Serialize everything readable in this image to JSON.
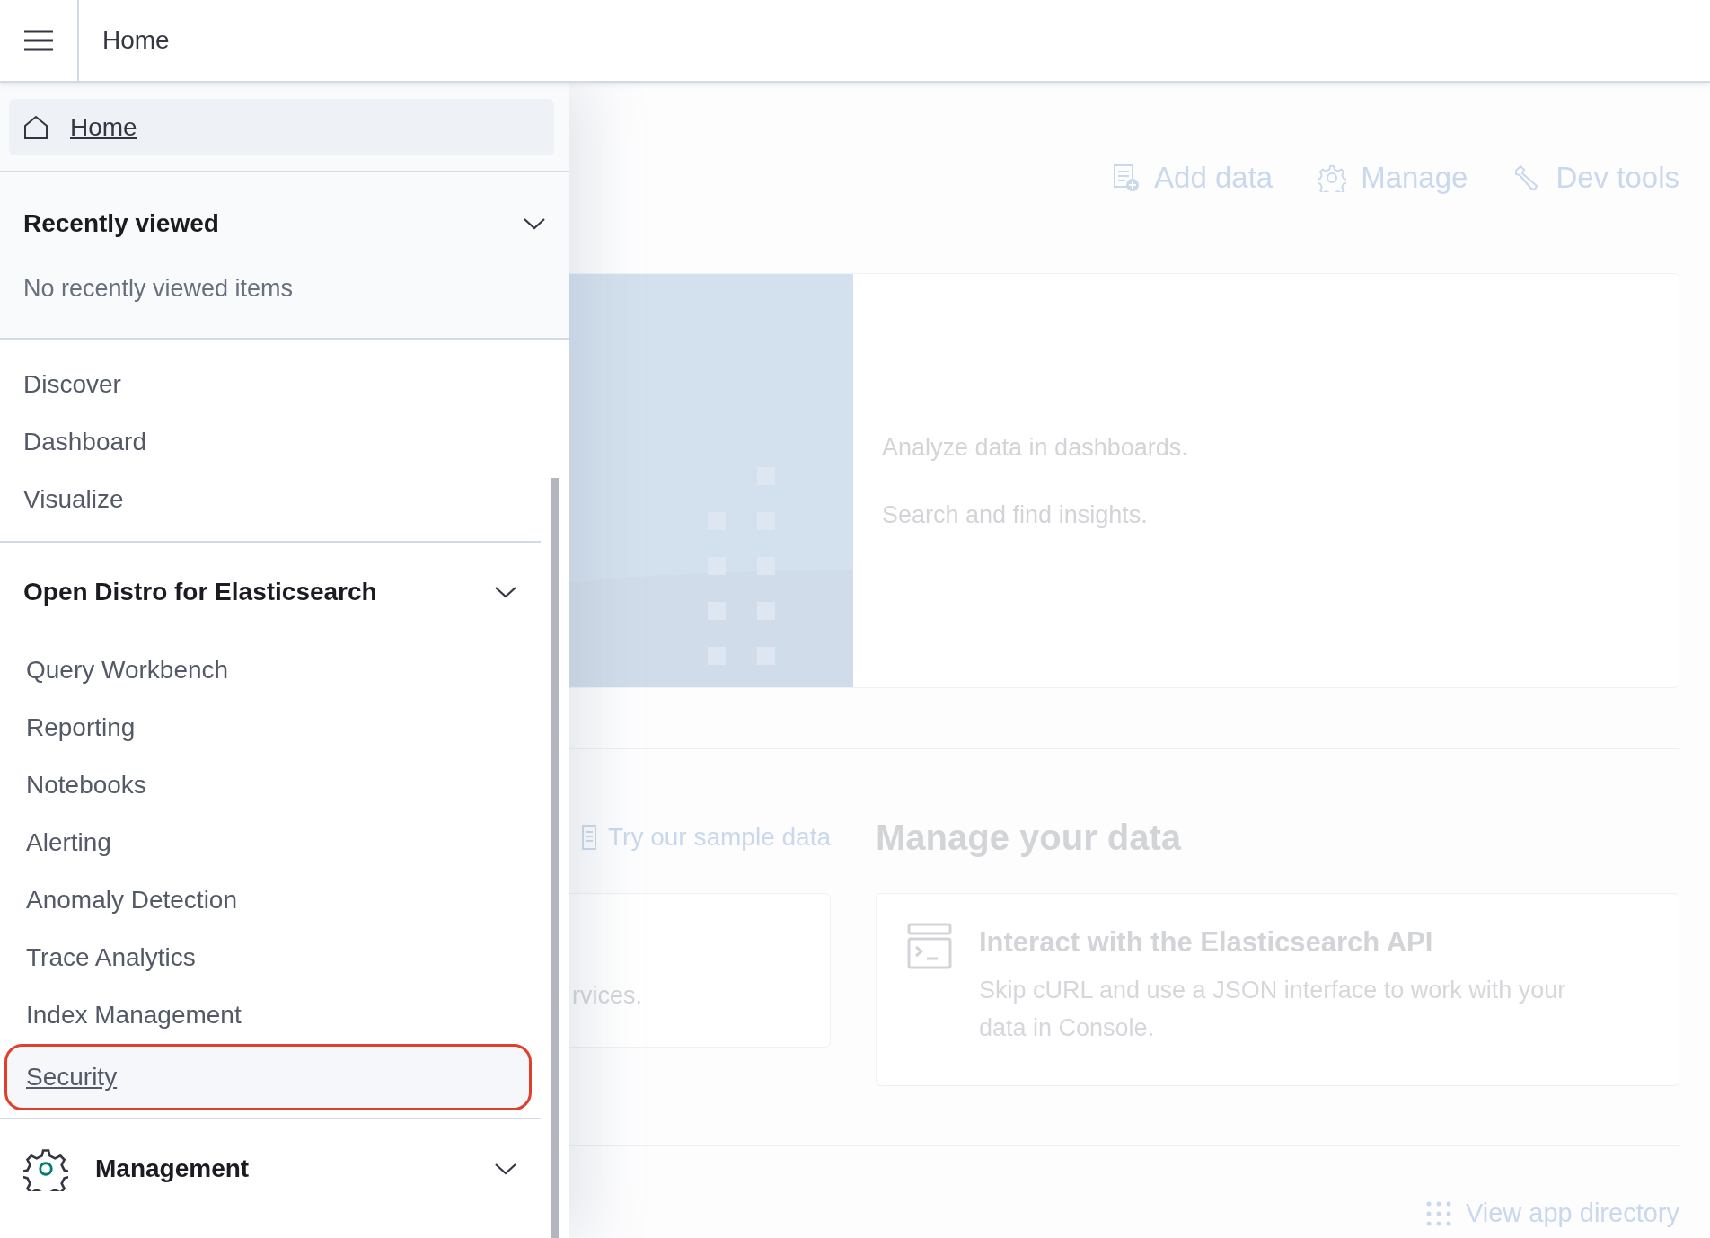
{
  "header": {
    "title": "Home"
  },
  "nav": {
    "home": {
      "label": "Home",
      "selected": true
    },
    "recent": {
      "title": "Recently viewed",
      "empty_text": "No recently viewed items"
    },
    "pinned": [
      {
        "label": "Discover",
        "selected": false
      },
      {
        "label": "Dashboard",
        "selected": false
      },
      {
        "label": "Visualize",
        "selected": false
      }
    ],
    "group": {
      "title": "Open Distro for Elasticsearch",
      "items": [
        {
          "label": "Query Workbench",
          "selected": false,
          "outlined": false
        },
        {
          "label": "Reporting",
          "selected": false,
          "outlined": false
        },
        {
          "label": "Notebooks",
          "selected": false,
          "outlined": false
        },
        {
          "label": "Alerting",
          "selected": false,
          "outlined": false
        },
        {
          "label": "Anomaly Detection",
          "selected": false,
          "outlined": false
        },
        {
          "label": "Trace Analytics",
          "selected": false,
          "outlined": false
        },
        {
          "label": "Index Management",
          "selected": false,
          "outlined": false
        },
        {
          "label": "Security",
          "selected": true,
          "outlined": true
        }
      ]
    },
    "management": {
      "title": "Management"
    }
  },
  "main": {
    "actions": [
      {
        "label": "Add data",
        "kind": "add"
      },
      {
        "label": "Manage",
        "kind": "manage"
      },
      {
        "label": "Dev tools",
        "kind": "tools"
      }
    ],
    "hero": {
      "lines": [
        "Analyze data in dashboards.",
        "Search and find insights."
      ]
    },
    "sample_link": "Try our sample data",
    "left_card_text": "rvices.",
    "manage": {
      "title": "Manage your data",
      "cards": [
        {
          "title": "Interact with the Elasticsearch API",
          "text": "Skip cURL and use a JSON interface to work with your data in Console."
        }
      ]
    },
    "app_directory": "View app directory"
  }
}
